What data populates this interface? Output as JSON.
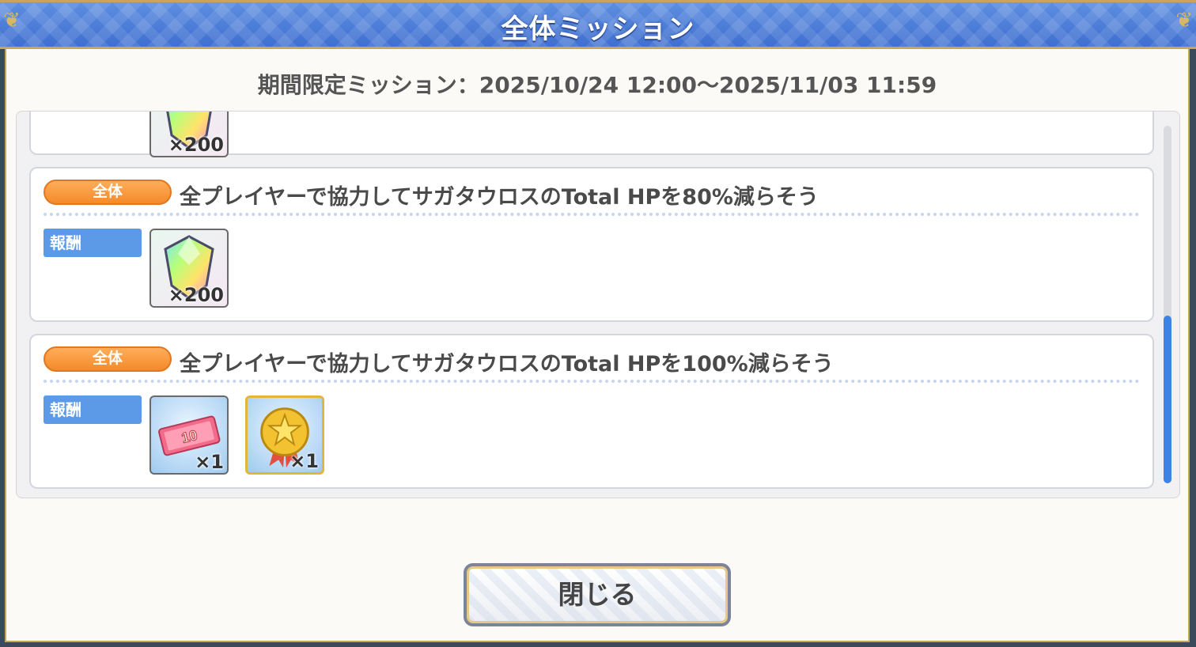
{
  "window": {
    "title": "全体ミッション"
  },
  "period_text": "期間限定ミッション：2025/10/24 12:00～2025/11/03 11:59",
  "missions": [
    {
      "rewards": [
        {
          "icon": "rainbow-gem-icon",
          "qty": "×200"
        }
      ]
    },
    {
      "badge": "全体",
      "text": "全プレイヤーで協力してサガタウロスのTotal HPを80%減らそう",
      "reward_label": "報酬",
      "rewards": [
        {
          "icon": "rainbow-gem-icon",
          "qty": "×200"
        }
      ]
    },
    {
      "badge": "全体",
      "text": "全プレイヤーで協力してサガタウロスのTotal HPを100%減らそう",
      "reward_label": "報酬",
      "rewards": [
        {
          "icon": "gacha-ticket-icon",
          "qty": "×1"
        },
        {
          "icon": "star-medal-icon",
          "qty": "×1"
        }
      ]
    }
  ],
  "close_button": {
    "label": "閉じる"
  },
  "colors": {
    "title_bar": "#4a7cd8",
    "badge_orange": "#f48a2a",
    "reward_label_blue": "#5c9ae8",
    "scrollbar_thumb": "#3d83e6",
    "gold_border": "#c7a658"
  }
}
